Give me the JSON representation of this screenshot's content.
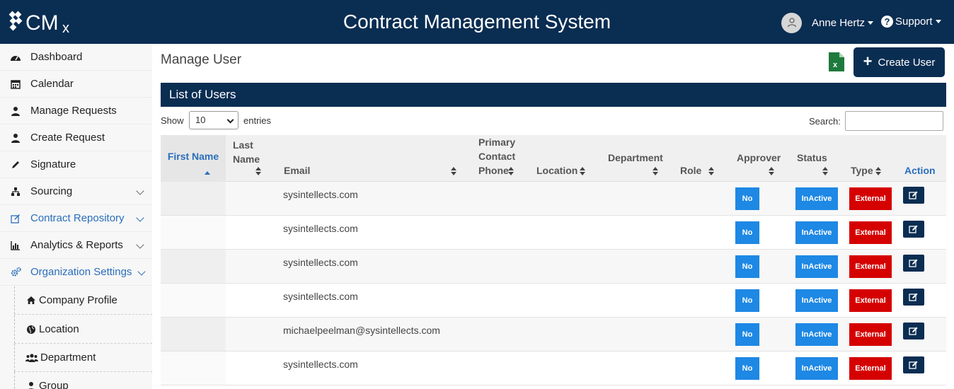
{
  "header": {
    "logo_text": "CMx",
    "title": "Contract Management System",
    "user_name": "Anne Hertz",
    "support_label": "Support"
  },
  "sidebar": {
    "items": [
      {
        "label": "Dashboard",
        "icon": "dashboard-icon"
      },
      {
        "label": "Calendar",
        "icon": "calendar-icon"
      },
      {
        "label": "Manage Requests",
        "icon": "user-tie-icon"
      },
      {
        "label": "Create Request",
        "icon": "user-tie-icon"
      },
      {
        "label": "Signature",
        "icon": "pen-icon"
      },
      {
        "label": "Sourcing",
        "icon": "sitemap-icon"
      },
      {
        "label": "Contract Repository",
        "icon": "edit-icon"
      },
      {
        "label": "Analytics & Reports",
        "icon": "bar-chart-icon"
      },
      {
        "label": "Organization Settings",
        "icon": "cogs-icon"
      }
    ],
    "subitems": [
      {
        "label": "Company Profile",
        "icon": "home-icon"
      },
      {
        "label": "Location",
        "icon": "globe-icon"
      },
      {
        "label": "Department",
        "icon": "users-icon"
      },
      {
        "label": "Group",
        "icon": "user-icon"
      }
    ]
  },
  "main": {
    "page_title": "Manage User",
    "create_label": "Create User",
    "panel_title": "List of Users",
    "show_label": "Show",
    "entries_value": "10",
    "entries_label": "entries",
    "search_label": "Search:",
    "search_value": ""
  },
  "table": {
    "columns": [
      "First Name",
      "Last Name",
      "Email",
      "Primary Contact Phone",
      "Location",
      "Department",
      "Role",
      "Approver",
      "Status",
      "Type",
      "Action"
    ],
    "rows": [
      {
        "email": "sysintellects.com",
        "approver": "No",
        "status": "InActive",
        "type": "External"
      },
      {
        "email": "sysintellects.com",
        "approver": "No",
        "status": "InActive",
        "type": "External"
      },
      {
        "email": "sysintellects.com",
        "approver": "No",
        "status": "InActive",
        "type": "External"
      },
      {
        "email": "sysintellects.com",
        "approver": "No",
        "status": "InActive",
        "type": "External"
      },
      {
        "email": "michaelpeelman@sysintellects.com",
        "approver": "No",
        "status": "InActive",
        "type": "External"
      },
      {
        "email": "sysintellects.com",
        "approver": "No",
        "status": "InActive",
        "type": "External"
      }
    ]
  },
  "colors": {
    "navy": "#0a2d52",
    "active_blue": "#2a6ebb",
    "badge_blue": "#1e88e5",
    "badge_red": "#d50000",
    "excel_green": "#1e7a3c"
  }
}
